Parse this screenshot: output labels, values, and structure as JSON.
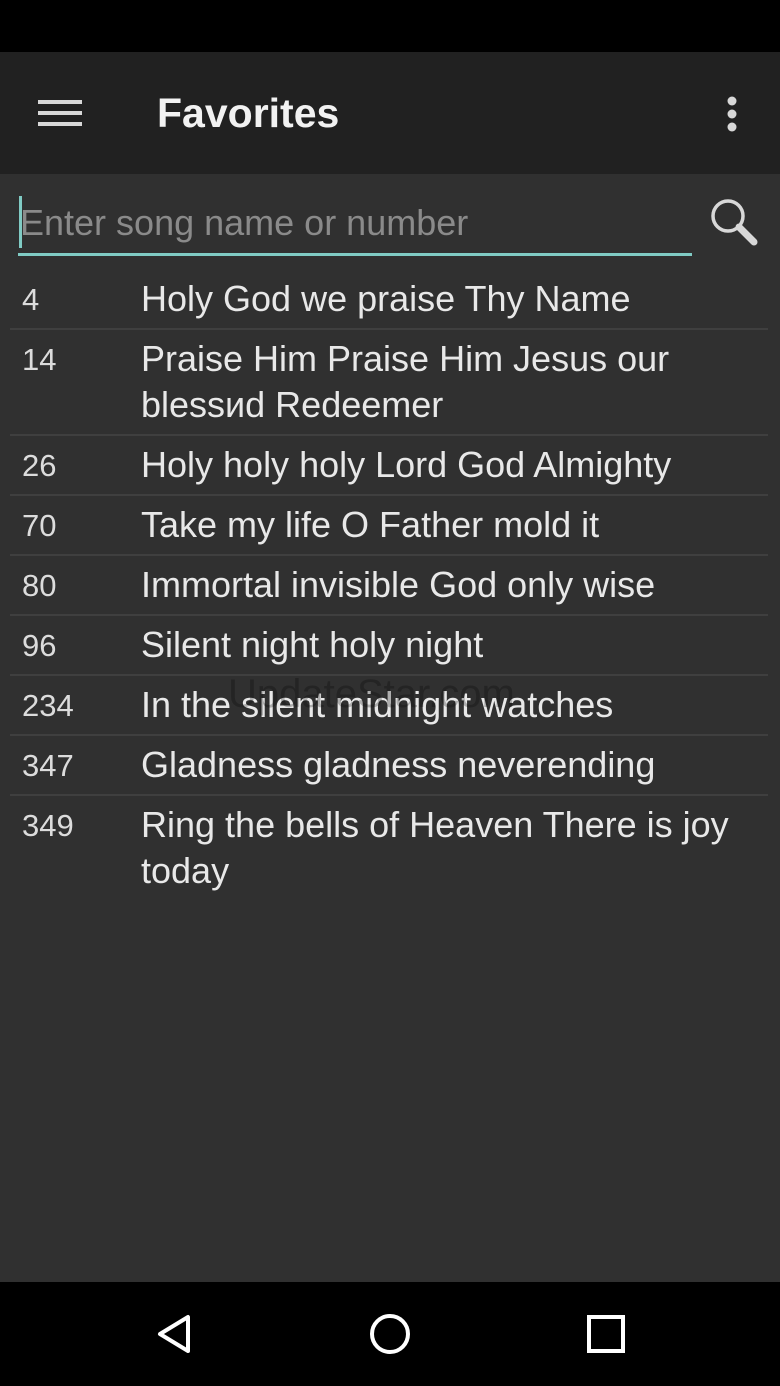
{
  "app_bar": {
    "title": "Favorites",
    "menu_icon": "hamburger-menu-icon",
    "overflow_icon": "more-vert-icon"
  },
  "search": {
    "placeholder": "Enter song name or number",
    "value": "",
    "icon": "search-icon"
  },
  "songs": [
    {
      "number": "4",
      "title": "Holy God we praise Thy Name"
    },
    {
      "number": "14",
      "title": "Praise Him Praise Him Jesus our blessиd Redeemer"
    },
    {
      "number": "26",
      "title": "Holy holy holy Lord God Almighty"
    },
    {
      "number": "70",
      "title": "Take my life O Father mold it"
    },
    {
      "number": "80",
      "title": "Immortal invisible God only wise"
    },
    {
      "number": "96",
      "title": "Silent night holy night"
    },
    {
      "number": "234",
      "title": "In the silent midnight watches"
    },
    {
      "number": "347",
      "title": "Gladness gladness neverending"
    },
    {
      "number": "349",
      "title": "Ring the bells of Heaven There is joy today"
    }
  ],
  "watermark": "UpdateStar.com",
  "nav": {
    "back_icon": "back-triangle-icon",
    "home_icon": "home-circle-icon",
    "recents_icon": "recents-square-icon"
  },
  "colors": {
    "accent": "#80cbc4",
    "app_bar": "#212121",
    "background": "#303030"
  }
}
